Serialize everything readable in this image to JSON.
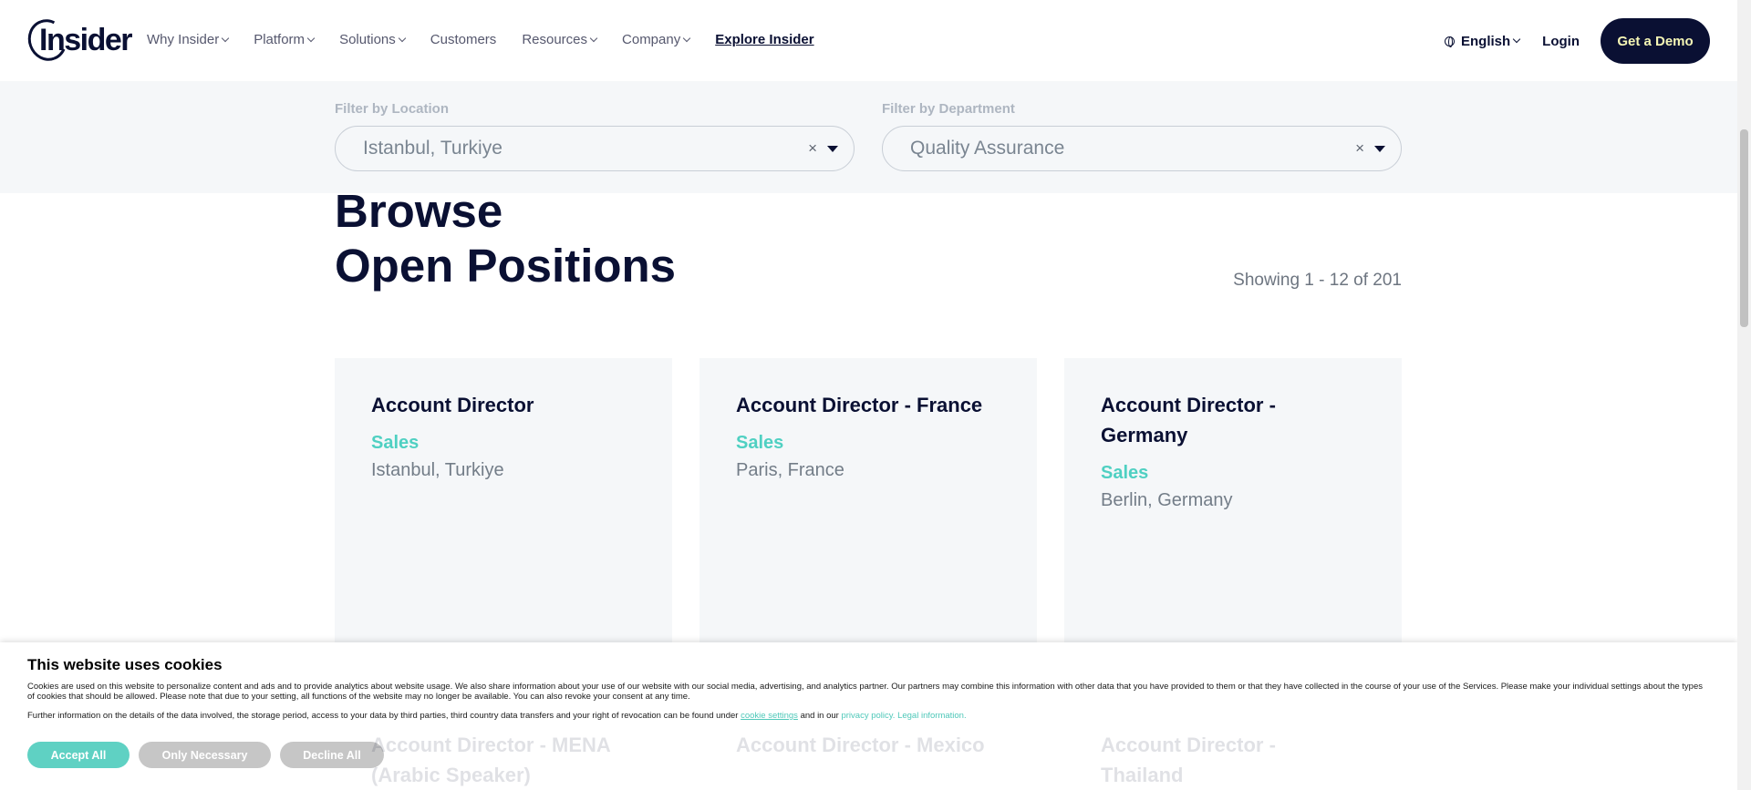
{
  "header": {
    "logo": "Insider",
    "nav": [
      {
        "label": "Why Insider",
        "dropdown": true
      },
      {
        "label": "Platform",
        "dropdown": true
      },
      {
        "label": "Solutions",
        "dropdown": true
      },
      {
        "label": "Customers",
        "dropdown": false
      },
      {
        "label": "Resources",
        "dropdown": true
      },
      {
        "label": "Company",
        "dropdown": true
      },
      {
        "label": "Explore Insider",
        "dropdown": false
      }
    ],
    "language": "English",
    "login": "Login",
    "demo": "Get a Demo"
  },
  "filters": {
    "location_label": "Filter by Location",
    "location_value": "Istanbul, Turkiye",
    "department_label": "Filter by Department",
    "department_value": "Quality Assurance",
    "clear_symbol": "×"
  },
  "main": {
    "title_line1": "Browse",
    "title_line2": "Open Positions",
    "showing": "Showing 1 - 12 of 201"
  },
  "jobs": [
    {
      "title": "Account Director",
      "department": "Sales",
      "location": "Istanbul, Turkiye"
    },
    {
      "title": "Account Director - France",
      "department": "Sales",
      "location": "Paris, France"
    },
    {
      "title": "Account Director - Germany",
      "department": "Sales",
      "location": "Berlin, Germany"
    },
    {
      "title": "Account Director - MENA (Arabic Speaker)",
      "department": "",
      "location": ""
    },
    {
      "title": "Account Director - Mexico",
      "department": "",
      "location": ""
    },
    {
      "title": "Account Director - Thailand",
      "department": "",
      "location": ""
    }
  ],
  "cookie": {
    "title": "This website uses cookies",
    "text": "Cookies are used on this website to personalize content and ads and to provide analytics about website usage. We also share information about your use of our website with our social media, advertising, and analytics partner. Our partners may combine this information with other data that you have provided to them or that they have collected in the course of your use of the Services. Please make your individual settings about the types of cookies that should be allowed. Please note that due to your setting, all functions of the website may no longer be available. You can also revoke your consent at any time.",
    "text2_prefix": "Further information on the details of the data involved, the storage period, access to your data by third parties, third country data transfers and your right of revocation can be found under",
    "cookie_settings_link": "cookie settings",
    "text2_middle": "and in our",
    "privacy_link": "privacy policy.",
    "legal_link": "Legal information.",
    "accept": "Accept All",
    "necessary": "Only Necessary",
    "decline": "Decline All"
  }
}
